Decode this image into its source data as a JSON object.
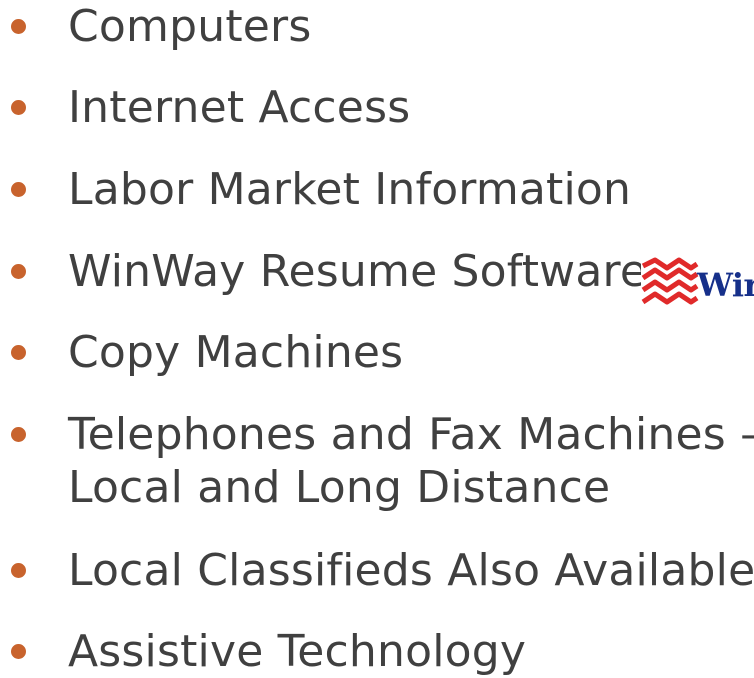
{
  "bullets": [
    {
      "text": "Computers"
    },
    {
      "text": "Internet Access"
    },
    {
      "text": "Labor Market Information"
    },
    {
      "text": "WinWay Resume Software"
    },
    {
      "text": "Copy Machines"
    },
    {
      "text": "Telephones and Fax Machines –",
      "text2": "Local and Long Distance"
    },
    {
      "text": "Local Classifieds Also Available"
    },
    {
      "text": "Assistive Technology"
    }
  ],
  "logo": {
    "text": "Wir",
    "icon": "winway-logo-icon",
    "colors": {
      "mark": "#e02a2a",
      "text": "#16308a"
    }
  },
  "colors": {
    "bullet": "#c8632d",
    "text": "#404040",
    "background": "#ffffff"
  }
}
